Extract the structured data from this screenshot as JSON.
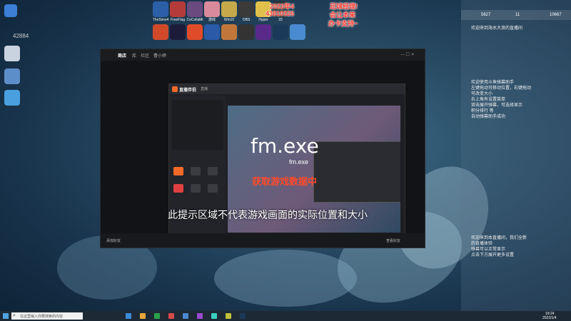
{
  "desktop": {
    "counter_badge": "42884",
    "top_icons": [
      "TheSims4",
      "FreeFlag",
      "CoCollaMi",
      "游戏",
      "Win10",
      "OBS",
      "Hyper",
      "22"
    ],
    "top_icons_row2": [
      "R",
      "AE",
      "PRO",
      "PS"
    ]
  },
  "overlay": {
    "line1": "2022年4",
    "line1_highlight": "足球经理!",
    "line2_left": "43810326",
    "line2_right": "会让本来",
    "line3_right": "办卡支持~"
  },
  "stream_window": {
    "title_tabs": [
      "商店",
      "库",
      "社区",
      "曹小婷"
    ],
    "inner_title": "直播伴侣",
    "inner_subtitle": "直播",
    "preview_title": "fm.exe",
    "preview_subtitle": "fm.exe",
    "capture_label": "获取游戏数据中",
    "notice": "此提示区域不代表游戏画面的实际位置和大小",
    "footer_left": "添加好友",
    "footer_right": "查看好友"
  },
  "chat": {
    "header_left": "5627",
    "header_mid": "11",
    "header_right": "10667",
    "welcome1": "欢迎来到海水大浪的直播间",
    "messages1": "欢迎使用斗鱼弹幕助手\n左键拖动可移动位置，右键拖动\n可改变大小\n右上角有设置菜单\n双击展开弹幕，可选择显示\n积分排行 等\n自动弹幕助手成功",
    "messages2": "欢迎来到本直播间，我们全新\n的直播体验\n弹幕可以正常显示\n点击下方展开更多设置"
  },
  "taskbar": {
    "search_placeholder": "在这里输入你要搜索的内容",
    "time": "19:24",
    "date": "2022/1/4"
  }
}
